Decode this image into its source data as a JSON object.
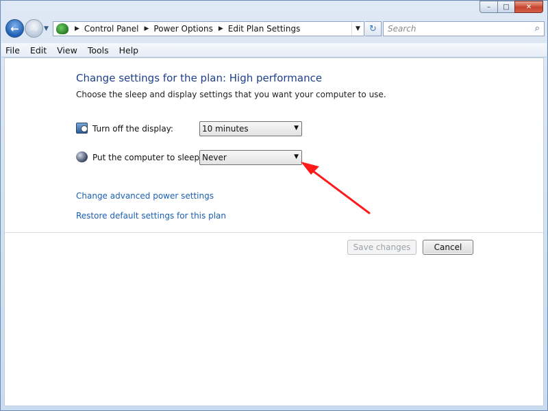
{
  "window": {
    "caption_minimize": "–",
    "caption_maximize": "□",
    "caption_close": "✕"
  },
  "nav": {
    "back_glyph": "←",
    "forward_glyph": "→",
    "dropdown_glyph": "▼",
    "breadcrumb": [
      "Control Panel",
      "Power Options",
      "Edit Plan Settings"
    ],
    "breadcrumb_sep": "▶",
    "refresh_glyph": "↻",
    "search_placeholder": "Search",
    "search_glyph": "⌕"
  },
  "menu": [
    "File",
    "Edit",
    "View",
    "Tools",
    "Help"
  ],
  "page": {
    "title": "Change settings for the plan: High performance",
    "subtitle": "Choose the sleep and display settings that you want your computer to use.",
    "settings": [
      {
        "label": "Turn off the display:",
        "value": "10 minutes",
        "icon": "display-clock-icon"
      },
      {
        "label": "Put the computer to sleep:",
        "value": "Never",
        "icon": "moon-sleep-icon"
      }
    ],
    "links": [
      "Change advanced power settings",
      "Restore default settings for this plan"
    ],
    "buttons": {
      "save": "Save changes",
      "cancel": "Cancel"
    },
    "dropdown_glyph": "▼"
  },
  "annotation": {
    "color": "#ff1a1a"
  }
}
